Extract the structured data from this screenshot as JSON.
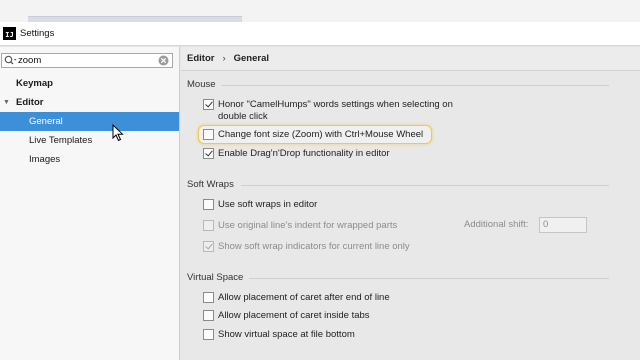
{
  "window": {
    "title": "Settings",
    "app_icon_text": "IJ"
  },
  "sidebar": {
    "search": {
      "value": "zoom",
      "placeholder": ""
    },
    "items": [
      {
        "label": "Keymap",
        "bold": true
      },
      {
        "label": "Editor",
        "bold": true,
        "expanded": true
      },
      {
        "label": "General",
        "selected": true
      },
      {
        "label": "Live Templates"
      },
      {
        "label": "Images"
      }
    ]
  },
  "breadcrumb": {
    "parent": "Editor",
    "separator": "›",
    "current": "General"
  },
  "sections": {
    "mouse": {
      "title": "Mouse",
      "options": [
        {
          "line1": "Honor \"CamelHumps\" words settings when selecting on",
          "line2": "double click",
          "checked": true
        },
        {
          "label": "Change font size (Zoom) with Ctrl+Mouse Wheel",
          "checked": false,
          "highlighted": true
        },
        {
          "label": "Enable Drag'n'Drop functionality in editor",
          "checked": true
        }
      ]
    },
    "soft_wraps": {
      "title": "Soft Wraps",
      "options": [
        {
          "label": "Use soft wraps in editor",
          "checked": false
        },
        {
          "label": "Use original line's indent for wrapped parts",
          "checked": false,
          "disabled": true
        },
        {
          "label": "Show soft wrap indicators for current line only",
          "checked": true,
          "disabled": true
        }
      ],
      "additional_shift": {
        "label": "Additional shift:",
        "value": "0"
      }
    },
    "virtual_space": {
      "title": "Virtual Space",
      "options": [
        {
          "label": "Allow placement of caret after end of line",
          "checked": false
        },
        {
          "label": "Allow placement of caret inside tabs",
          "checked": false
        },
        {
          "label": "Show virtual space at file bottom",
          "checked": false
        }
      ]
    }
  },
  "colors": {
    "selection": "#3d8fd9",
    "highlight_ring": "#f0c84a"
  }
}
